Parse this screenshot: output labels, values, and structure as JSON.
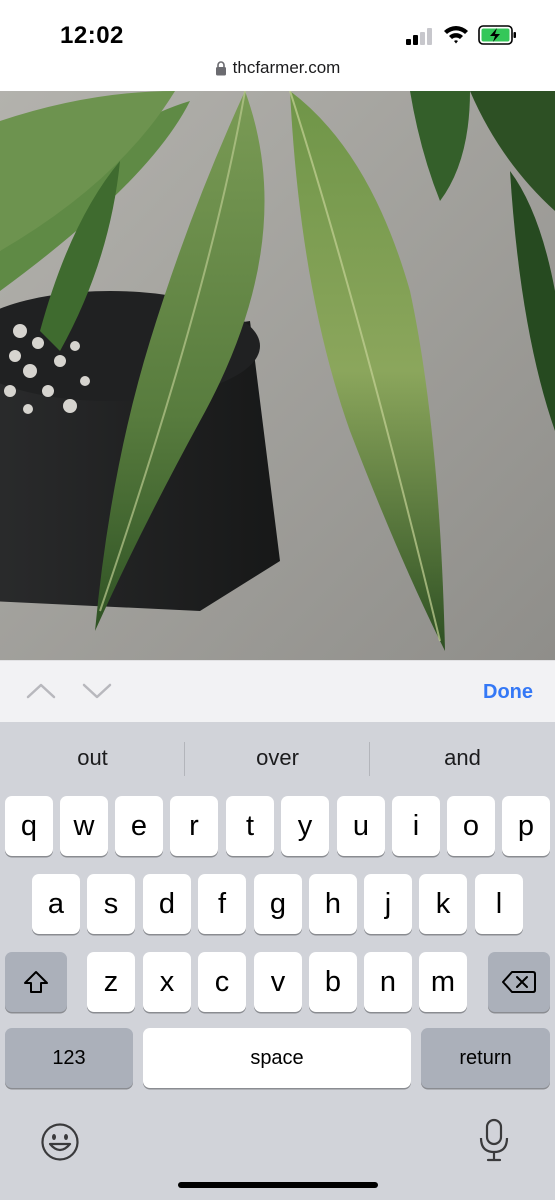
{
  "status_bar": {
    "time": "12:02",
    "signal_icon": "cellular-signal-icon",
    "wifi_icon": "wifi-icon",
    "battery_icon": "battery-charging-icon"
  },
  "browser": {
    "url": "thcfarmer.com",
    "lock_icon": "lock-icon"
  },
  "accessory_bar": {
    "prev_icon": "chevron-up-icon",
    "next_icon": "chevron-down-icon",
    "done_label": "Done",
    "accent": "#3478f6"
  },
  "keyboard": {
    "suggestions": [
      "out",
      "over",
      "and"
    ],
    "row1": [
      "q",
      "w",
      "e",
      "r",
      "t",
      "y",
      "u",
      "i",
      "o",
      "p"
    ],
    "row2": [
      "a",
      "s",
      "d",
      "f",
      "g",
      "h",
      "j",
      "k",
      "l"
    ],
    "row3": [
      "z",
      "x",
      "c",
      "v",
      "b",
      "n",
      "m"
    ],
    "shift_icon": "shift-icon",
    "delete_icon": "backspace-icon",
    "numbers_label": "123",
    "space_label": "space",
    "return_label": "return",
    "emoji_icon": "emoji-icon",
    "mic_icon": "microphone-icon"
  }
}
